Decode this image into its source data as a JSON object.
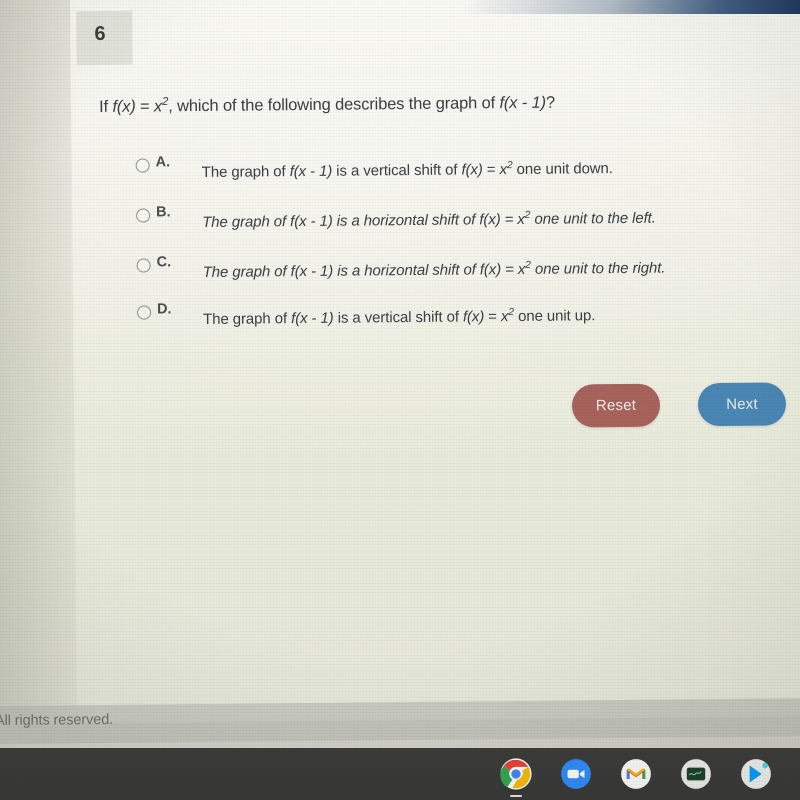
{
  "quiz": {
    "question_number": "6",
    "stem": {
      "prefix": "If ",
      "f1": "f",
      "arg1": "(x)",
      "eq": " = ",
      "base": "x",
      "exp": "2",
      "middle": ", which of the following describes the graph of ",
      "f2": "f",
      "arg2": "(x - 1)",
      "suffix": "?"
    },
    "options": [
      {
        "letter": "A.",
        "selected": false,
        "pre": "The graph of ",
        "f1": "f",
        "arg1": "(x - 1)",
        "mid": " is a vertical shift of ",
        "f2": "f",
        "arg2": "(x)",
        "eq": " = ",
        "base": "x",
        "exp": "2",
        "post": " one unit down."
      },
      {
        "letter": "B.",
        "selected": false,
        "pre": "The graph of ",
        "f1": "f",
        "arg1": "(x - 1)",
        "mid": " is a horizontal shift of ",
        "f2": "f",
        "arg2": "(x)",
        "eq": " = ",
        "base": "x",
        "exp": "2",
        "post": " one unit to the left."
      },
      {
        "letter": "C.",
        "selected": false,
        "pre": "The graph of ",
        "f1": "f",
        "arg1": "(x - 1)",
        "mid": " is a horizontal shift of ",
        "f2": "f",
        "arg2": "(x)",
        "eq": " = ",
        "base": "x",
        "exp": "2",
        "post": " one unit to the right."
      },
      {
        "letter": "D.",
        "selected": false,
        "pre": "The graph of ",
        "f1": "f",
        "arg1": "(x - 1)",
        "mid": " is a vertical shift of ",
        "f2": "f",
        "arg2": "(x)",
        "eq": " = ",
        "base": "x",
        "exp": "2",
        "post": " one unit up."
      }
    ],
    "buttons": {
      "reset_label": "Reset",
      "next_label": "Next",
      "reset_color": "#a8635c",
      "next_color": "#4a87b5"
    },
    "footer_text": "All rights reserved."
  },
  "taskbar": {
    "items": [
      {
        "name": "chrome-icon",
        "label": "Chrome",
        "running": true
      },
      {
        "name": "zoom-icon",
        "label": "Zoom",
        "running": false
      },
      {
        "name": "gmail-icon",
        "label": "Gmail",
        "running": false
      },
      {
        "name": "calculator-icon",
        "label": "Calculator",
        "running": false
      },
      {
        "name": "play-store-icon",
        "label": "Play Store",
        "running": false
      }
    ]
  }
}
